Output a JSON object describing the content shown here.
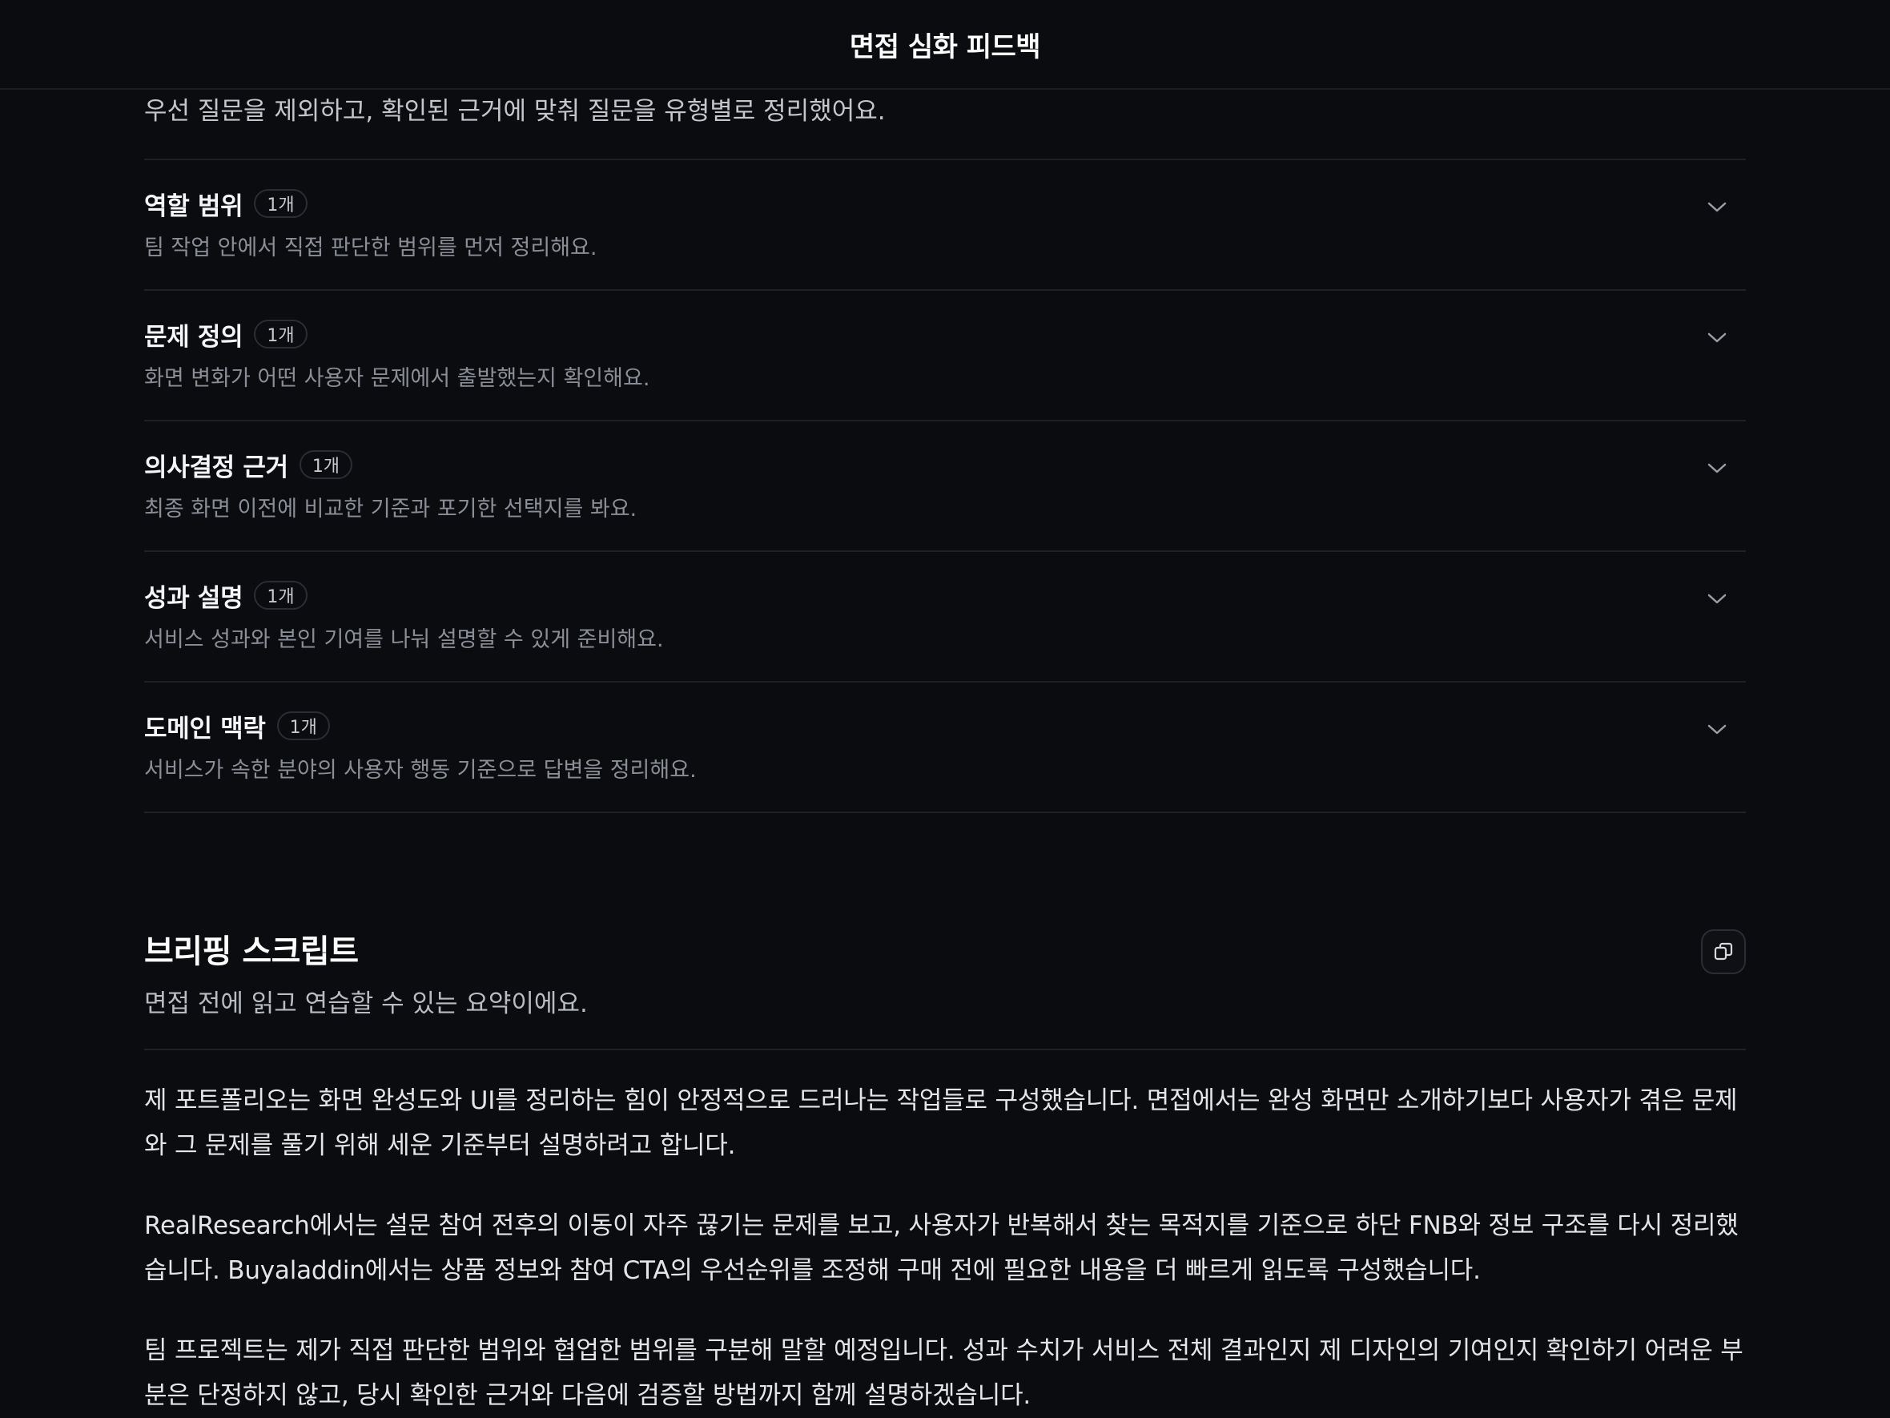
{
  "header": {
    "title": "면접 심화 피드백"
  },
  "intro": "우선 질문을 제외하고, 확인된 근거에 맞춰 질문을 유형별로 정리했어요.",
  "categories": [
    {
      "title": "역할 범위",
      "count": "1개",
      "description": "팀 작업 안에서 직접 판단한 범위를 먼저 정리해요."
    },
    {
      "title": "문제 정의",
      "count": "1개",
      "description": "화면 변화가 어떤 사용자 문제에서 출발했는지 확인해요."
    },
    {
      "title": "의사결정 근거",
      "count": "1개",
      "description": "최종 화면 이전에 비교한 기준과 포기한 선택지를 봐요."
    },
    {
      "title": "성과 설명",
      "count": "1개",
      "description": "서비스 성과와 본인 기여를 나눠 설명할 수 있게 준비해요."
    },
    {
      "title": "도메인 맥락",
      "count": "1개",
      "description": "서비스가 속한 분야의 사용자 행동 기준으로 답변을 정리해요."
    }
  ],
  "briefing": {
    "title": "브리핑 스크립트",
    "subtitle": "면접 전에 읽고 연습할 수 있는 요약이에요.",
    "paragraphs": [
      "제 포트폴리오는 화면 완성도와 UI를 정리하는 힘이 안정적으로 드러나는 작업들로 구성했습니다. 면접에서는 완성 화면만 소개하기보다 사용자가 겪은 문제와 그 문제를 풀기 위해 세운 기준부터 설명하려고 합니다.",
      "RealResearch에서는 설문 참여 전후의 이동이 자주 끊기는 문제를 보고, 사용자가 반복해서 찾는 목적지를 기준으로 하단 FNB와 정보 구조를 다시 정리했습니다. Buyaladdin에서는 상품 정보와 참여 CTA의 우선순위를 조정해 구매 전에 필요한 내용을 더 빠르게 읽도록 구성했습니다.",
      "팀 프로젝트는 제가 직접 판단한 범위와 협업한 범위를 구분해 말할 예정입니다. 성과 수치가 서비스 전체 결과인지 제 디자인의 기여인지 확인하기 어려운 부분은 단정하지 않고, 당시 확인한 근거와 다음에 검증할 방법까지 함께 설명하겠습니다."
    ]
  },
  "icons": {
    "expand": "chevron-down-icon",
    "copy": "copy-icon"
  },
  "colors": {
    "background": "#0b0c0f",
    "divider": "#1f2026",
    "muted_text": "#8b8e96"
  }
}
